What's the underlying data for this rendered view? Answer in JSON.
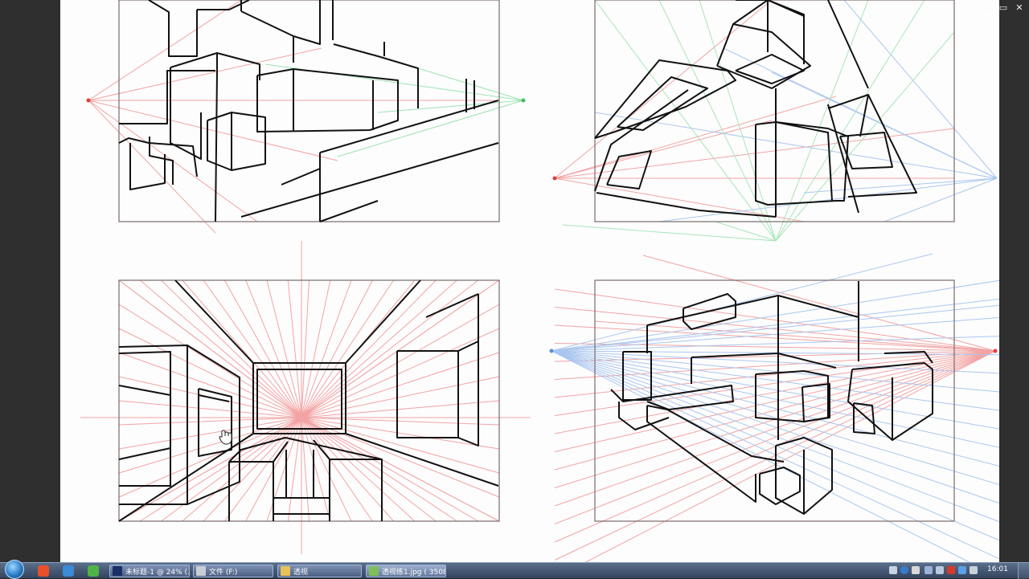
{
  "window_controls": {
    "minimize": "–",
    "restore": "▭",
    "close": "✕"
  },
  "taskbar": {
    "buttons": [
      {
        "label": "未标题-1 @ 24% (…",
        "icon": "photoshop-icon",
        "color": "#1b2f6b"
      },
      {
        "label": "文件 (F:)",
        "icon": "drive-icon",
        "color": "#c9ced6"
      },
      {
        "label": "透视",
        "icon": "folder-icon",
        "color": "#e8c15a"
      },
      {
        "label": "透视练1.jpg ( 3508…",
        "icon": "image-viewer-icon",
        "color": "#7fbf5a"
      }
    ]
  },
  "tray": {
    "clock": "16:01"
  },
  "drawing": {
    "panels": [
      "two-point-perspective-buildings",
      "three-point-perspective",
      "one-point-interior",
      "two-point-city-blocks"
    ],
    "colors": {
      "line": "#111111",
      "red_guides": "#f08c8c",
      "blue_guides": "#8cb4ec",
      "green_guides": "#8ed8a2",
      "frame": "#7a6a6a"
    }
  }
}
